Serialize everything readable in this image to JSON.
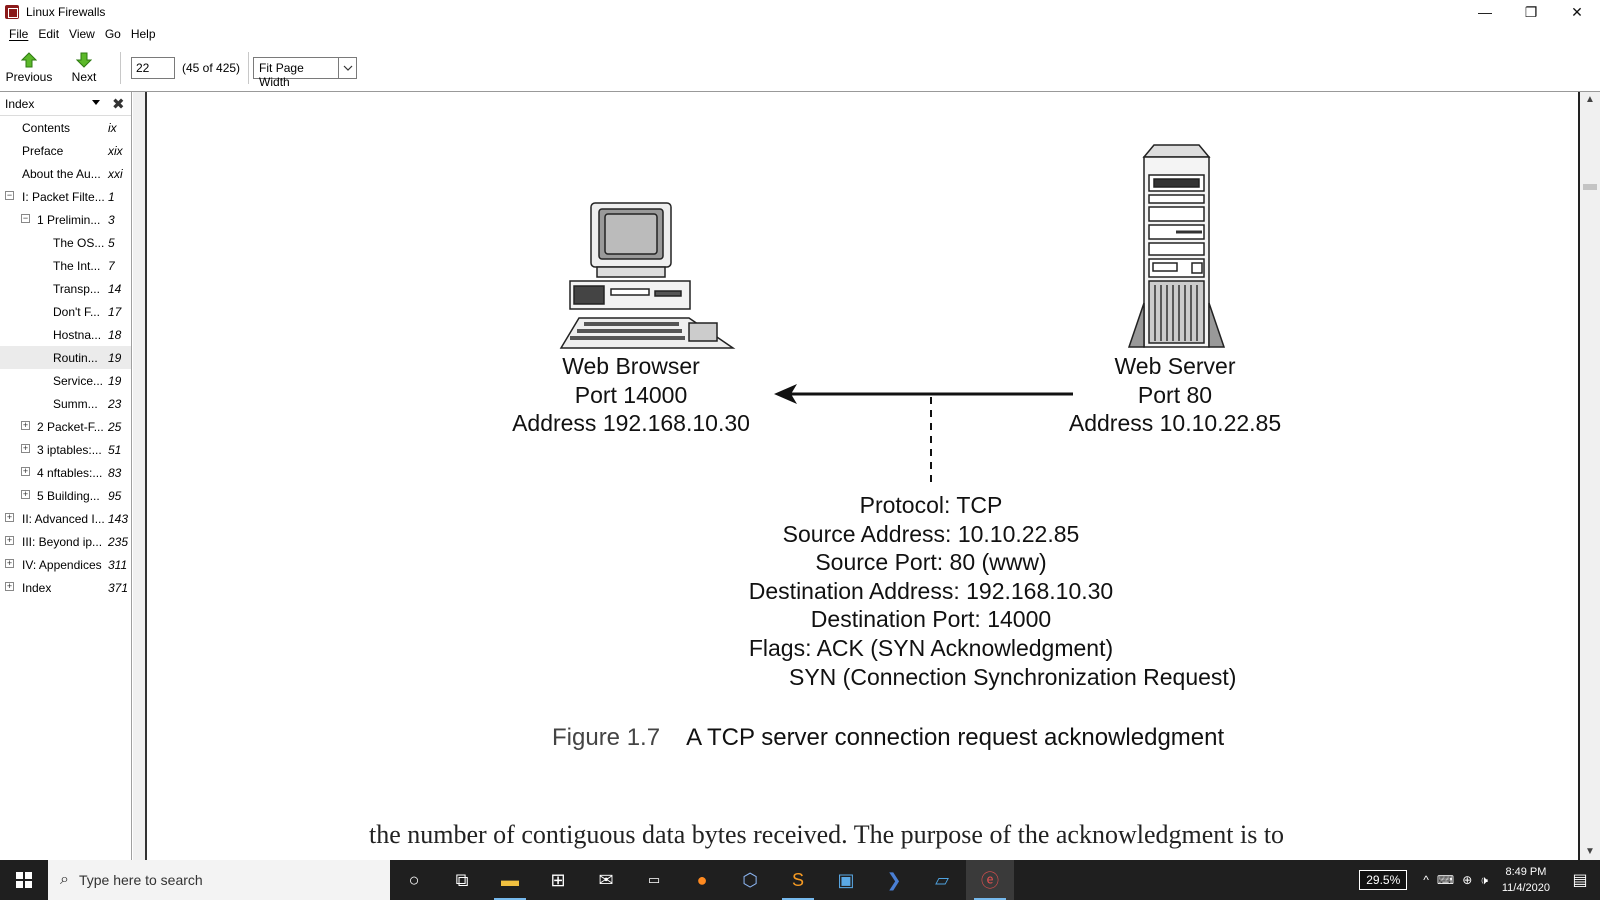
{
  "window": {
    "title": "Linux Firewalls",
    "minimize": "—",
    "restore": "❐",
    "close": "✕"
  },
  "menu": {
    "items": [
      "File",
      "Edit",
      "View",
      "Go",
      "Help"
    ]
  },
  "toolbar": {
    "previous_label": "Previous",
    "next_label": "Next",
    "page_value": "22",
    "page_count": "(45 of 425)",
    "zoom_value": "Fit Page Width"
  },
  "sidebar": {
    "title": "Index",
    "items": [
      {
        "label": "Contents",
        "page": "ix",
        "level": 0,
        "exp": ""
      },
      {
        "label": "Preface",
        "page": "xix",
        "level": 0,
        "exp": ""
      },
      {
        "label": "About the Au...",
        "page": "xxi",
        "level": 0,
        "exp": ""
      },
      {
        "label": "I: Packet Filte...",
        "page": "1",
        "level": 0,
        "exp": "−"
      },
      {
        "label": "1 Prelimin...",
        "page": "3",
        "level": 1,
        "exp": "−"
      },
      {
        "label": "The OS...",
        "page": "5",
        "level": 2,
        "exp": ""
      },
      {
        "label": "The Int...",
        "page": "7",
        "level": 2,
        "exp": ""
      },
      {
        "label": "Transp...",
        "page": "14",
        "level": 2,
        "exp": ""
      },
      {
        "label": "Don't F...",
        "page": "17",
        "level": 2,
        "exp": ""
      },
      {
        "label": "Hostna...",
        "page": "18",
        "level": 2,
        "exp": ""
      },
      {
        "label": "Routin...",
        "page": "19",
        "level": 2,
        "exp": "",
        "selected": true
      },
      {
        "label": "Service...",
        "page": "19",
        "level": 2,
        "exp": ""
      },
      {
        "label": "Summ...",
        "page": "23",
        "level": 2,
        "exp": ""
      },
      {
        "label": "2 Packet-F...",
        "page": "25",
        "level": 1,
        "exp": "+"
      },
      {
        "label": "3 iptables:...",
        "page": "51",
        "level": 1,
        "exp": "+"
      },
      {
        "label": "4 nftables:...",
        "page": "83",
        "level": 1,
        "exp": "+"
      },
      {
        "label": "5 Building...",
        "page": "95",
        "level": 1,
        "exp": "+"
      },
      {
        "label": "II: Advanced I...",
        "page": "143",
        "level": 0,
        "exp": "+"
      },
      {
        "label": "III: Beyond ip...",
        "page": "235",
        "level": 0,
        "exp": "+"
      },
      {
        "label": "IV: Appendices",
        "page": "311",
        "level": 0,
        "exp": "+"
      },
      {
        "label": "Index",
        "page": "371",
        "level": 0,
        "exp": "+"
      }
    ]
  },
  "figure": {
    "client_lines": [
      "Web Browser",
      "Port 14000",
      "Address 192.168.10.30"
    ],
    "server_lines": [
      "Web Server",
      "Port 80",
      "Address 10.10.22.85"
    ],
    "packet_lines": [
      "Protocol: TCP",
      "Source Address: 10.10.22.85",
      "Source Port: 80 (www)",
      "Destination Address: 192.168.10.30",
      "Destination Port: 14000",
      "Flags: ACK (SYN Acknowledgment)",
      "SYN (Connection Synchronization Request)"
    ],
    "caption_number": "Figure 1.7",
    "caption_text": "A TCP server connection request acknowledgment"
  },
  "body_text": "the number of contiguous data bytes received. The purpose of the acknowledgment is to",
  "taskbar": {
    "search_placeholder": "Type here to search",
    "zoom_badge": "29.5%",
    "time": "8:49 PM",
    "date": "11/4/2020"
  }
}
